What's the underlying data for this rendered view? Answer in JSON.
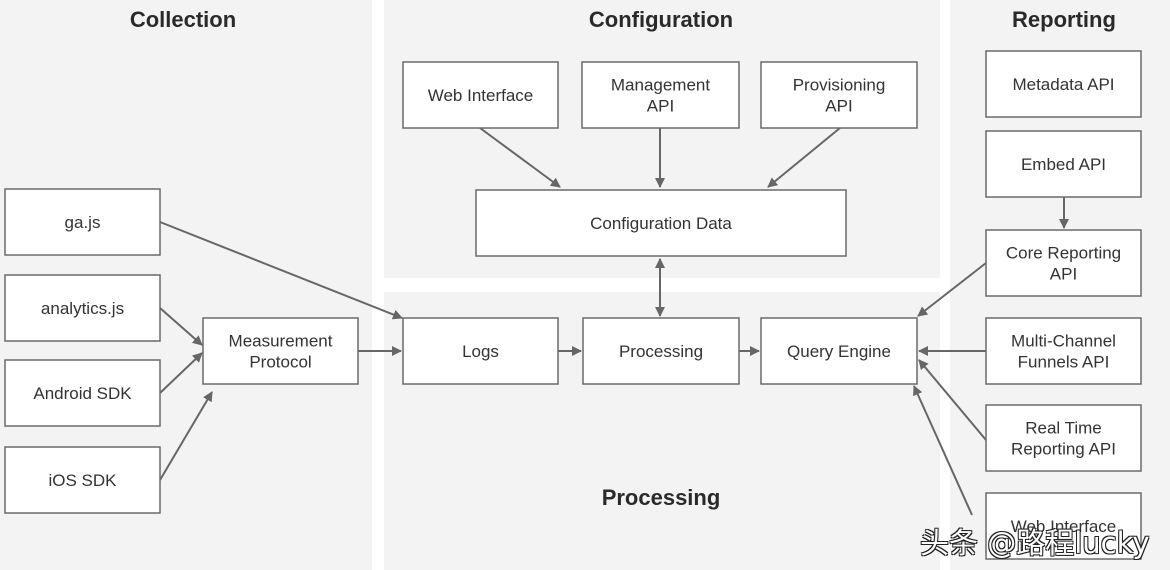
{
  "sections": {
    "collection": "Collection",
    "configuration": "Configuration",
    "processing": "Processing",
    "reporting": "Reporting"
  },
  "boxes": {
    "ga_js": [
      "ga.js"
    ],
    "analytics_js": [
      "analytics.js"
    ],
    "android_sdk": [
      "Android SDK"
    ],
    "ios_sdk": [
      "iOS SDK"
    ],
    "measurement_protocol": [
      "Measurement",
      "Protocol"
    ],
    "config_web_interface": [
      "Web Interface"
    ],
    "management_api": [
      "Management",
      "API"
    ],
    "provisioning_api": [
      "Provisioning",
      "API"
    ],
    "configuration_data": [
      "Configuration Data"
    ],
    "logs": [
      "Logs"
    ],
    "processing": [
      "Processing"
    ],
    "query_engine": [
      "Query Engine"
    ],
    "metadata_api": [
      "Metadata API"
    ],
    "embed_api": [
      "Embed API"
    ],
    "core_reporting_api": [
      "Core Reporting",
      "API"
    ],
    "multi_channel_funnels_api": [
      "Multi-Channel",
      "Funnels API"
    ],
    "real_time_reporting_api": [
      "Real Time",
      "Reporting API"
    ],
    "reporting_web_interface": [
      "Web Interface"
    ]
  },
  "watermark": "头条 @路程lucky"
}
